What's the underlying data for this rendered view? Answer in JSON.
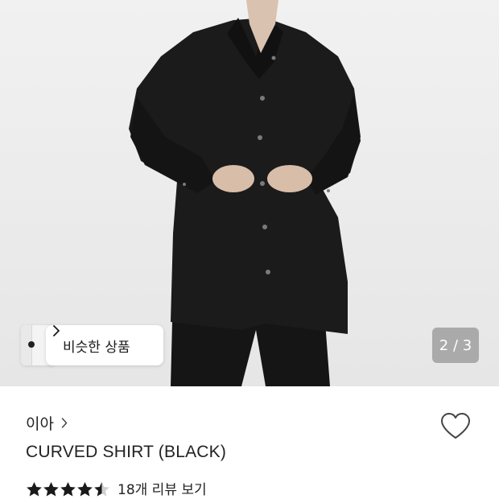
{
  "gallery": {
    "similar_products_label": "비슷한 상품",
    "page_current": "2",
    "page_separator": "/",
    "page_total": "3",
    "page_indicator_text": "2 / 3"
  },
  "product": {
    "brand": "이아",
    "name": "CURVED SHIRT (BLACK)",
    "rating": 4.5,
    "rating_max": 5,
    "review_link": "18개 리뷰 보기"
  },
  "icons": {
    "similar_chevron": "chevron-right-icon",
    "brand_chevron": "chevron-right-icon",
    "wishlist": "heart-outline-icon",
    "star": "star-icon"
  },
  "colors": {
    "text": "#222222",
    "indicator_bg": "#969696",
    "star": "#1a1a1a"
  }
}
